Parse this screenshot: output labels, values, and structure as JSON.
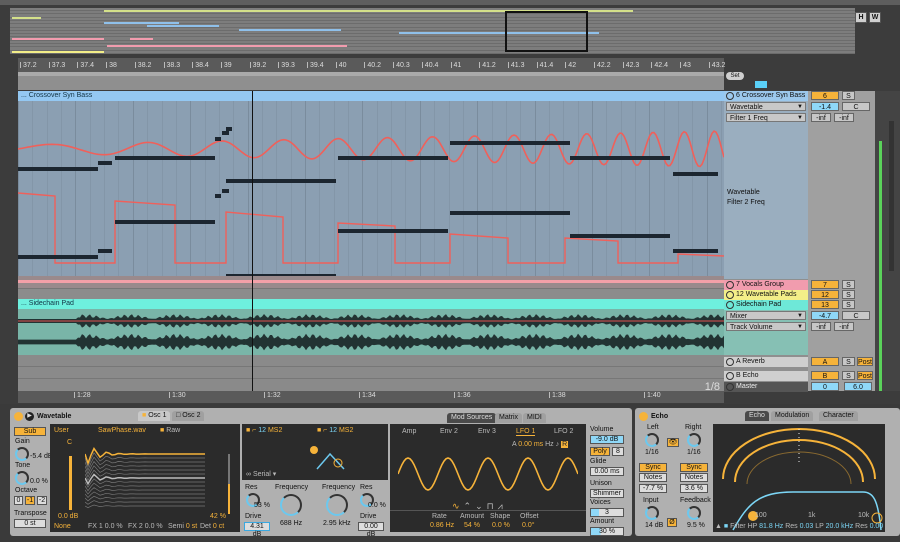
{
  "overview": {
    "buttons": [
      "H",
      "W"
    ]
  },
  "ruler": {
    "bars": [
      "37.2",
      "37.3",
      "37.4",
      "38",
      "38.2",
      "38.3",
      "38.4",
      "39",
      "39.2",
      "39.3",
      "39.4",
      "40",
      "40.2",
      "40.3",
      "40.4",
      "41",
      "41.2",
      "41.3",
      "41.4",
      "42",
      "42.2",
      "42.3",
      "42.4",
      "43",
      "43.2"
    ]
  },
  "time_ruler": {
    "labels": [
      "1:28",
      "1:30",
      "1:32",
      "1:34",
      "1:36",
      "1:38",
      "1:40"
    ],
    "grid": "1/8"
  },
  "set_label": "Set",
  "clips": {
    "bass_title": "... Crossover Syn Bass",
    "pad_title": "... Sidechain Pad"
  },
  "tracks": [
    {
      "name": "6 Crossover Syn Bass",
      "color": "#9cc8ec",
      "number": "6",
      "solo": "S",
      "device": "Wavetable",
      "param": "Filter 1 Freq",
      "value": "-1.4",
      "pan": "C",
      "min": "-inf",
      "max": "-inf",
      "lane2_device": "Wavetable",
      "lane2_param": "Filter 2 Freq"
    },
    {
      "name": "7 Vocals Group",
      "color": "#f19cae",
      "number": "7",
      "solo": "S"
    },
    {
      "name": "12 Wavetable Pads",
      "color": "#f3ee88",
      "number": "12",
      "solo": "S"
    },
    {
      "name": "Sidechain Pad",
      "color": "#6ee8d8",
      "number": "13",
      "solo": "S",
      "device": "Mixer",
      "param": "Track Volume",
      "value": "-4.7",
      "pan": "C",
      "min": "-inf",
      "max": "-inf"
    },
    {
      "name": "A Reverb",
      "color": "#cfcfcf",
      "number": "A",
      "solo": "S",
      "post": "Post"
    },
    {
      "name": "B Echo",
      "color": "#cfcfcf",
      "number": "B",
      "solo": "S",
      "post": "Post"
    },
    {
      "name": "Master",
      "color": "#555555",
      "number": "0",
      "volume": "6.0"
    }
  ],
  "wavetable": {
    "title": "Wavetable",
    "tabs": [
      "Osc 1",
      "Osc 2"
    ],
    "sub": "Sub",
    "gain_label": "Gain",
    "gain": "-5.4 dB",
    "tone_label": "Tone",
    "tone": "0.0 %",
    "octave_label": "Octave",
    "octaves": [
      "0",
      "-1",
      "-2"
    ],
    "transpose_label": "Transpose",
    "transpose": "0 st",
    "category": "User",
    "wavetable_file": "SawPhase.wav",
    "raw": "Raw",
    "pitch_mark": "C",
    "osc_gain": "0.0 dB",
    "position": "42 %",
    "fx_mode": "None",
    "fx1": "FX 1 0.0 %",
    "fx2": "FX 2 0.0 %",
    "semi_label": "Semi",
    "semi": "0 st",
    "det_label": "Det",
    "det": "0 ct",
    "filter1": {
      "slope": "12",
      "type": "MS2",
      "res_label": "Res",
      "res": "53 %",
      "freq_label": "Frequency",
      "freq": "688 Hz",
      "drive_label": "Drive",
      "drive": "4.31 dB"
    },
    "filter2": {
      "slope": "12",
      "type": "MS2",
      "res_label": "Res",
      "res": "0.0 %",
      "freq_label": "Frequency",
      "freq": "2.95 kHz",
      "drive_label": "Drive",
      "drive": "0.00 dB"
    },
    "routing": "Serial",
    "mod_tabs": [
      "Mod Sources",
      "Matrix",
      "MIDI"
    ],
    "mod_source_tabs": [
      "Amp",
      "Env 2",
      "Env 3",
      "LFO 1",
      "LFO 2"
    ],
    "lfo": {
      "attack_label": "A",
      "attack": "0.00 ms",
      "hz": "Hz",
      "rate_label": "Rate",
      "rate": "0.86 Hz",
      "amount_label": "Amount",
      "amount": "54 %",
      "shape_label": "Shape",
      "shape": "0.0 %",
      "offset_label": "Offset",
      "offset": "0.0°",
      "r": "R"
    },
    "global": {
      "volume_label": "Volume",
      "volume": "-9.0 dB",
      "poly": "Poly",
      "voices_count": "8",
      "glide_label": "Glide",
      "glide": "0.00 ms",
      "unison_label": "Unison",
      "unison": "Shimmer",
      "voices_label": "Voices",
      "voices": "3",
      "amount_label": "Amount",
      "amount": "30 %",
      "amount_fraction": 0.3
    }
  },
  "echo": {
    "title": "Echo",
    "tabs": [
      "Echo",
      "Modulation",
      "Character"
    ],
    "left_label": "Left",
    "left": "1/16",
    "right_label": "Right",
    "right": "1/16",
    "sync": "Sync",
    "mode": "Notes",
    "left_offset": "-7.7 %",
    "right_offset": "3.6 %",
    "input_label": "Input",
    "input": "14 dB",
    "feedback_label": "Feedback",
    "feedback": "9.5 %",
    "phase": "Ø",
    "freq_labels": [
      "100",
      "1k",
      "10k"
    ],
    "filter_label": "Filter",
    "hp_label": "HP",
    "hp": "81.8 Hz",
    "res_label": "Res",
    "res1": "0.03",
    "lp_label": "LP",
    "lp": "20.0 kHz",
    "res2": "0.00"
  },
  "colors": {
    "accent": "#f6b33a",
    "blue": "#7cd6f6",
    "automation": "#f0605a"
  }
}
